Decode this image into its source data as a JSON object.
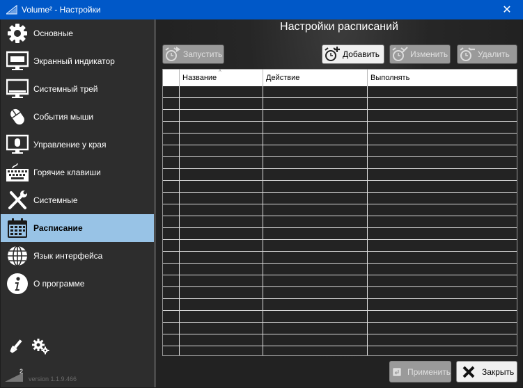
{
  "window": {
    "title": "Volume² - Настройки",
    "close_glyph": "✕"
  },
  "sidebar": {
    "items": [
      {
        "label": "Основные",
        "icon": "gear-icon",
        "active": false
      },
      {
        "label": "Экранный индикатор",
        "icon": "monitor-indicator-icon",
        "active": false
      },
      {
        "label": "Системный трей",
        "icon": "system-tray-icon",
        "active": false
      },
      {
        "label": "События мыши",
        "icon": "mouse-icon",
        "active": false
      },
      {
        "label": "Управление у края",
        "icon": "edge-control-icon",
        "active": false
      },
      {
        "label": "Горячие клавиши",
        "icon": "keyboard-icon",
        "active": false
      },
      {
        "label": "Системные",
        "icon": "tools-icon",
        "active": false
      },
      {
        "label": "Расписание",
        "icon": "calendar-icon",
        "active": true
      },
      {
        "label": "Язык интерфейса",
        "icon": "globe-icon",
        "active": false
      },
      {
        "label": "О программе",
        "icon": "info-icon",
        "active": false
      }
    ],
    "version": "version 1.1.9.466",
    "logo_superscript": "2"
  },
  "main": {
    "heading": "Настройки расписаний",
    "toolbar": {
      "run_label": "Запустить",
      "add_label": "Добавить",
      "edit_label": "Изменить",
      "delete_label": "Удалить"
    },
    "table": {
      "columns": [
        "",
        "Название",
        "Действие",
        "Выполнять"
      ],
      "sort_arrow": "^",
      "rows": []
    },
    "footer": {
      "apply_label": "Применить",
      "close_label": "Закрыть"
    }
  },
  "colors": {
    "titlebar": "#0058c8",
    "active_item": "#98c3e6",
    "sidebar_bg": "#2d2d2d"
  }
}
